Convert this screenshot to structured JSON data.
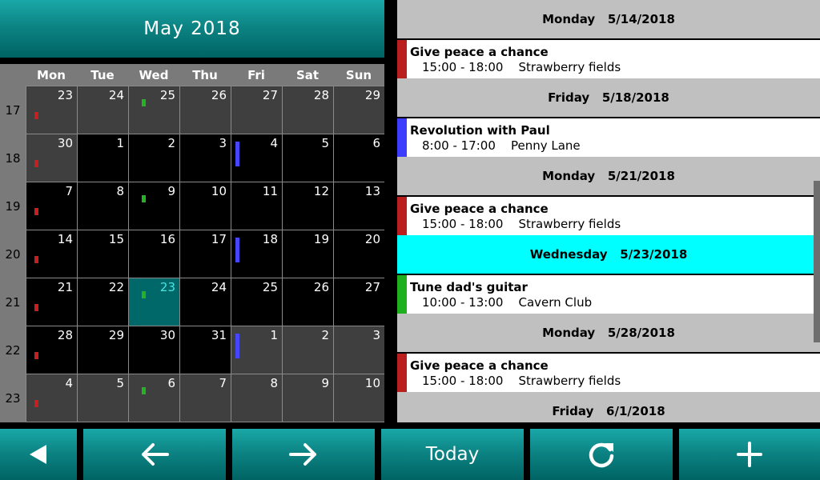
{
  "header": {
    "title": "May 2018"
  },
  "calendar": {
    "weekdays": [
      "Mon",
      "Tue",
      "Wed",
      "Thu",
      "Fri",
      "Sat",
      "Sun"
    ],
    "weeks": [
      {
        "number": "17",
        "days": [
          {
            "n": "23",
            "in_month": false,
            "marker": "red"
          },
          {
            "n": "24",
            "in_month": false
          },
          {
            "n": "25",
            "in_month": false,
            "marker": "green"
          },
          {
            "n": "26",
            "in_month": false
          },
          {
            "n": "27",
            "in_month": false
          },
          {
            "n": "28",
            "in_month": false
          },
          {
            "n": "29",
            "in_month": false
          }
        ]
      },
      {
        "number": "18",
        "days": [
          {
            "n": "30",
            "in_month": false,
            "marker": "red"
          },
          {
            "n": "1",
            "in_month": true
          },
          {
            "n": "2",
            "in_month": true
          },
          {
            "n": "3",
            "in_month": true
          },
          {
            "n": "4",
            "in_month": true,
            "marker": "blue"
          },
          {
            "n": "5",
            "in_month": true
          },
          {
            "n": "6",
            "in_month": true
          }
        ]
      },
      {
        "number": "19",
        "days": [
          {
            "n": "7",
            "in_month": true,
            "marker": "red"
          },
          {
            "n": "8",
            "in_month": true
          },
          {
            "n": "9",
            "in_month": true,
            "marker": "green"
          },
          {
            "n": "10",
            "in_month": true
          },
          {
            "n": "11",
            "in_month": true
          },
          {
            "n": "12",
            "in_month": true
          },
          {
            "n": "13",
            "in_month": true
          }
        ]
      },
      {
        "number": "20",
        "days": [
          {
            "n": "14",
            "in_month": true,
            "marker": "red"
          },
          {
            "n": "15",
            "in_month": true
          },
          {
            "n": "16",
            "in_month": true
          },
          {
            "n": "17",
            "in_month": true
          },
          {
            "n": "18",
            "in_month": true,
            "marker": "blue"
          },
          {
            "n": "19",
            "in_month": true
          },
          {
            "n": "20",
            "in_month": true
          }
        ]
      },
      {
        "number": "21",
        "days": [
          {
            "n": "21",
            "in_month": true,
            "marker": "red"
          },
          {
            "n": "22",
            "in_month": true
          },
          {
            "n": "23",
            "in_month": true,
            "marker": "green",
            "today": true
          },
          {
            "n": "24",
            "in_month": true
          },
          {
            "n": "25",
            "in_month": true
          },
          {
            "n": "26",
            "in_month": true
          },
          {
            "n": "27",
            "in_month": true
          }
        ]
      },
      {
        "number": "22",
        "days": [
          {
            "n": "28",
            "in_month": true,
            "marker": "red"
          },
          {
            "n": "29",
            "in_month": true
          },
          {
            "n": "30",
            "in_month": true
          },
          {
            "n": "31",
            "in_month": true
          },
          {
            "n": "1",
            "in_month": false,
            "marker": "blue"
          },
          {
            "n": "2",
            "in_month": false
          },
          {
            "n": "3",
            "in_month": false
          }
        ]
      },
      {
        "number": "23",
        "days": [
          {
            "n": "4",
            "in_month": false,
            "marker": "red"
          },
          {
            "n": "5",
            "in_month": false
          },
          {
            "n": "6",
            "in_month": false,
            "marker": "green"
          },
          {
            "n": "7",
            "in_month": false
          },
          {
            "n": "8",
            "in_month": false
          },
          {
            "n": "9",
            "in_month": false
          },
          {
            "n": "10",
            "in_month": false
          }
        ]
      }
    ]
  },
  "agenda": [
    {
      "day": "Monday",
      "date": "5/14/2018",
      "highlight": false,
      "event": {
        "title": "Give peace a chance",
        "time": "15:00 - 18:00",
        "location": "Strawberry fields",
        "color": "#b91f1f"
      }
    },
    {
      "day": "Friday",
      "date": "5/18/2018",
      "highlight": false,
      "event": {
        "title": "Revolution with Paul",
        "time": "8:00 - 17:00",
        "location": "Penny Lane",
        "color": "#3d3dff"
      }
    },
    {
      "day": "Monday",
      "date": "5/21/2018",
      "highlight": false,
      "event": {
        "title": "Give peace a chance",
        "time": "15:00 - 18:00",
        "location": "Strawberry fields",
        "color": "#b91f1f"
      }
    },
    {
      "day": "Wednesday",
      "date": "5/23/2018",
      "highlight": true,
      "event": {
        "title": "Tune dad's guitar",
        "time": "10:00 - 13:00",
        "location": "Cavern Club",
        "color": "#1fb01f"
      }
    },
    {
      "day": "Monday",
      "date": "5/28/2018",
      "highlight": false,
      "event": {
        "title": "Give peace a chance",
        "time": "15:00 - 18:00",
        "location": "Strawberry fields",
        "color": "#b91f1f"
      }
    },
    {
      "day": "Friday",
      "date": "6/1/2018",
      "highlight": false,
      "event": null
    }
  ],
  "toolbar": {
    "back_icon": "triangle-left-icon",
    "prev_icon": "arrow-left-icon",
    "next_icon": "arrow-right-icon",
    "today_label": "Today",
    "refresh_icon": "refresh-icon",
    "add_icon": "plus-icon"
  },
  "colors": {
    "teal_top": "#1aa8a8",
    "teal_bottom": "#006363",
    "today_cell": "#006868",
    "highlight_row": "#00ffff",
    "marker_red": "#c42020",
    "marker_green": "#22b422",
    "marker_blue": "#4646ff"
  }
}
